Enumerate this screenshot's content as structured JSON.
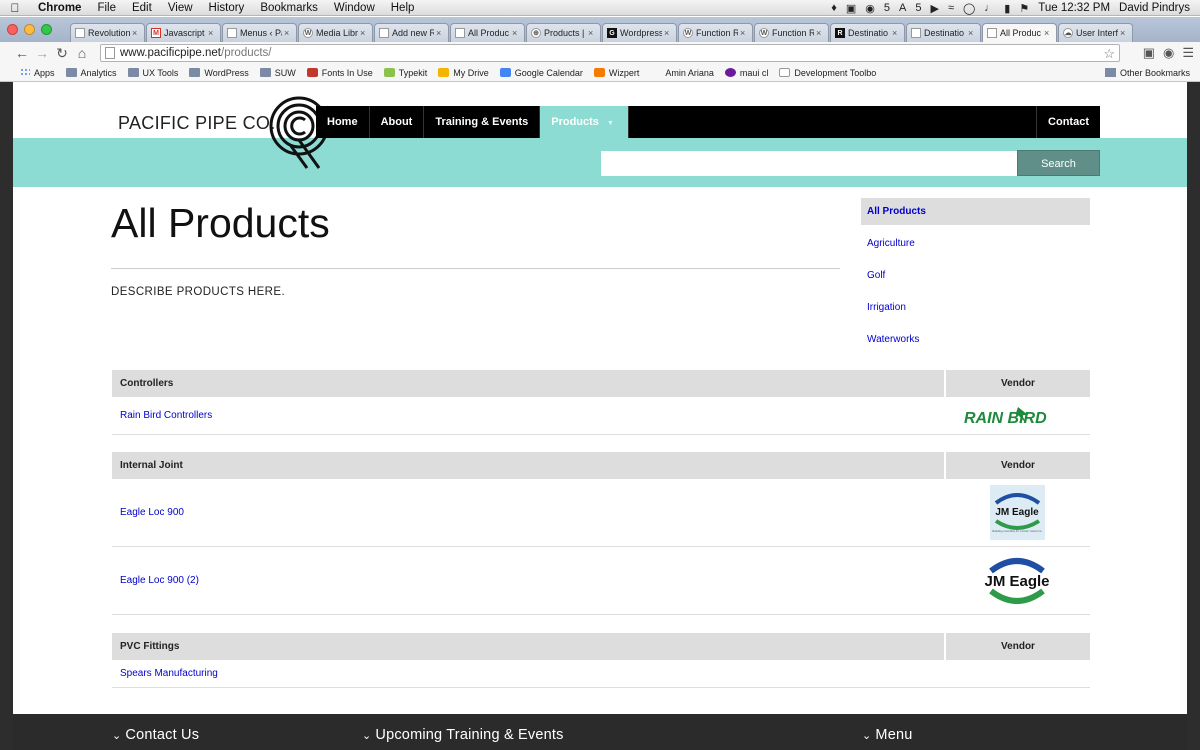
{
  "menubar": {
    "items": [
      "Chrome",
      "File",
      "Edit",
      "View",
      "History",
      "Bookmarks",
      "Window",
      "Help"
    ],
    "badge1": "5",
    "badge2": "5",
    "clock": "Tue 12:32 PM",
    "user": "David Pindrys"
  },
  "tabs": [
    {
      "label": "Revolution",
      "icon": "page"
    },
    {
      "label": "Javascript",
      "icon": "gmail"
    },
    {
      "label": "Menus ‹ Pa",
      "icon": "page"
    },
    {
      "label": "Media Libr",
      "icon": "wordpress"
    },
    {
      "label": "Add new R",
      "icon": "page"
    },
    {
      "label": "All Produc",
      "icon": "page"
    },
    {
      "label": "Products |",
      "icon": "pacific"
    },
    {
      "label": "Wordpress",
      "icon": "g-dark"
    },
    {
      "label": "Function R",
      "icon": "wordpress"
    },
    {
      "label": "Function R",
      "icon": "wordpress"
    },
    {
      "label": "Destinatio",
      "icon": "r-dark"
    },
    {
      "label": "Destinatio",
      "icon": "page"
    },
    {
      "label": "All Produc",
      "icon": "page",
      "active": true
    },
    {
      "label": "User Interf",
      "icon": "cloud"
    }
  ],
  "toolbar": {
    "url_host": "www.pacificpipe.net",
    "url_path": "/products/"
  },
  "bookmarks": [
    {
      "label": "Apps",
      "icon": "apps"
    },
    {
      "label": "Analytics",
      "icon": "folder"
    },
    {
      "label": "UX Tools",
      "icon": "folder"
    },
    {
      "label": "WordPress",
      "icon": "folder"
    },
    {
      "label": "SUW",
      "icon": "folder"
    },
    {
      "label": "Fonts In Use",
      "icon": "grid"
    },
    {
      "label": "Typekit",
      "icon": "typekit"
    },
    {
      "label": "My Drive",
      "icon": "drive"
    },
    {
      "label": "Google Calendar",
      "icon": "calendar"
    },
    {
      "label": "Wizpert",
      "icon": "wizpert"
    },
    {
      "label": "Amin Ariana",
      "icon": "aa"
    },
    {
      "label": "maui cl",
      "icon": "peace"
    },
    {
      "label": "Development Toolbo",
      "icon": "page"
    }
  ],
  "bookmarks_other": "Other Bookmarks",
  "site": {
    "logo": "PACIFIC PIPE CO.",
    "nav": [
      "Home",
      "About",
      "Training & Events",
      "Products"
    ],
    "nav_active": "Products",
    "nav_contact": "Contact",
    "search_button": "Search",
    "search_value": ""
  },
  "content": {
    "title": "All Products",
    "description": "DESCRIBE PRODUCTS HERE."
  },
  "subnav": [
    "All Products",
    "Agriculture",
    "Golf",
    "Irrigation",
    "Waterworks"
  ],
  "product_groups": [
    {
      "category": "Controllers",
      "vendor_header": "Vendor",
      "rows": [
        {
          "name": "Rain Bird Controllers",
          "vendor_logo": "rainbird",
          "vendor_text": "RAIN BIRD"
        }
      ]
    },
    {
      "category": "Internal Joint",
      "vendor_header": "Vendor",
      "rows": [
        {
          "name": "Eagle Loc 900",
          "vendor_logo": "jmeagle-small",
          "vendor_text": "JM Eagle",
          "vendor_tagline": "Building essentials for a better tomorrow"
        },
        {
          "name": "Eagle Loc 900 (2)",
          "vendor_logo": "jmeagle",
          "vendor_text": "JM Eagle"
        }
      ]
    },
    {
      "category": "PVC Fittings",
      "vendor_header": "Vendor",
      "rows": [
        {
          "name": "Spears Manufacturing",
          "vendor_logo": "",
          "vendor_text": ""
        }
      ]
    }
  ],
  "footer": [
    "Contact Us",
    "Upcoming Training & Events",
    "Menu"
  ],
  "colors": {
    "teal": "#8cdcd3",
    "nav_black": "#000000",
    "link_blue": "#0000cc",
    "search_button": "#5f8f88",
    "rainbird_green": "#1e8a3c",
    "jm_blue": "#1f4ea3",
    "jm_green": "#2e9b4a"
  }
}
